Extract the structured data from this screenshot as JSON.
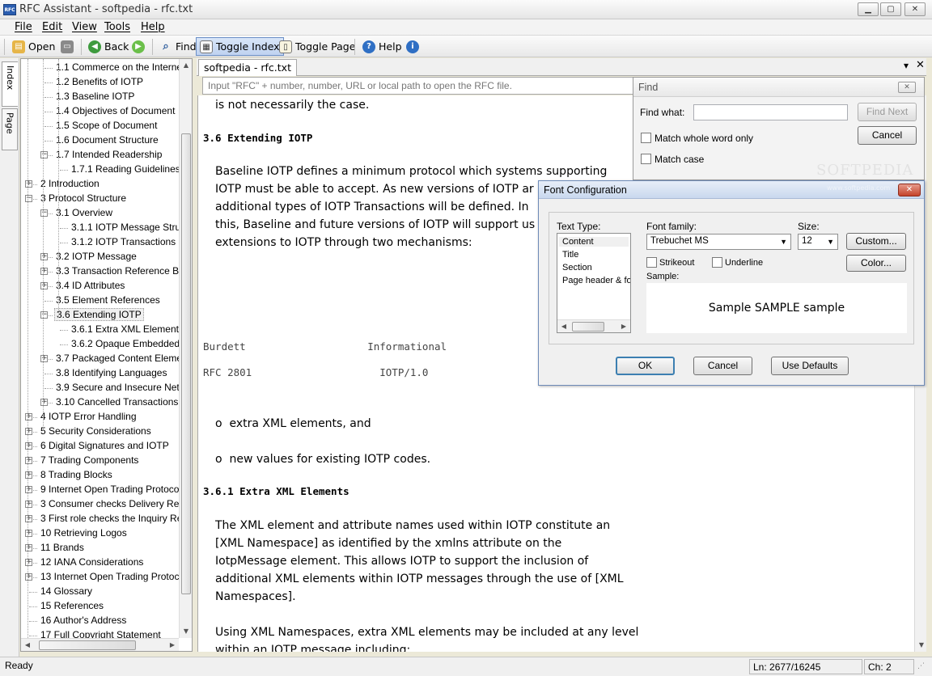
{
  "window": {
    "title": "RFC Assistant - softpedia - rfc.txt",
    "app_icon_text": "RFC",
    "minimize_glyph": "▁",
    "maximize_glyph": "▢",
    "close_glyph": "✕"
  },
  "menu": [
    {
      "label": "File"
    },
    {
      "label": "Edit"
    },
    {
      "label": "View"
    },
    {
      "label": "Tools"
    },
    {
      "label": "Help"
    }
  ],
  "toolbar": {
    "open_label": "Open",
    "back_label": "Back",
    "find_label": "Find",
    "toggle_index_label": "Toggle Index",
    "toggle_page_label": "Toggle Page",
    "help_label": "Help",
    "icons": [
      "folder-open-icon",
      "printer-icon",
      "back-arrow-icon",
      "forward-arrow-icon",
      "magnifier-icon",
      "toggle-index-icon",
      "toggle-page-icon",
      "help-icon",
      "info-icon"
    ]
  },
  "side_tabs": {
    "index_label": "Index",
    "page_label": "Page"
  },
  "tree": [
    {
      "label": "1.1 Commerce on the Interne",
      "depth": 2
    },
    {
      "label": "1.2 Benefits of IOTP",
      "depth": 2
    },
    {
      "label": "1.3 Baseline IOTP",
      "depth": 2
    },
    {
      "label": "1.4 Objectives of Document",
      "depth": 2
    },
    {
      "label": "1.5 Scope of Document",
      "depth": 2
    },
    {
      "label": "1.6 Document Structure",
      "depth": 2
    },
    {
      "label": "1.7 Intended Readership",
      "depth": 2,
      "expander": "−"
    },
    {
      "label": "1.7.1 Reading Guidelines",
      "depth": 3
    },
    {
      "label": "2 Introduction",
      "depth": 1,
      "expander": "+"
    },
    {
      "label": "3 Protocol Structure",
      "depth": 1,
      "expander": "−"
    },
    {
      "label": "3.1 Overview",
      "depth": 2,
      "expander": "−"
    },
    {
      "label": "3.1.1 IOTP Message Struc",
      "depth": 3
    },
    {
      "label": "3.1.2 IOTP Transactions",
      "depth": 3
    },
    {
      "label": "3.2 IOTP Message",
      "depth": 2,
      "expander": "+"
    },
    {
      "label": "3.3 Transaction Reference Blo",
      "depth": 2,
      "expander": "+"
    },
    {
      "label": "3.4 ID Attributes",
      "depth": 2,
      "expander": "+"
    },
    {
      "label": "3.5 Element References",
      "depth": 2
    },
    {
      "label": "3.6 Extending IOTP",
      "depth": 2,
      "expander": "−",
      "selected": true
    },
    {
      "label": "3.6.1 Extra XML Elements",
      "depth": 3
    },
    {
      "label": "3.6.2 Opaque Embedded",
      "depth": 3
    },
    {
      "label": "3.7 Packaged Content Eleme",
      "depth": 2,
      "expander": "+"
    },
    {
      "label": "3.8 Identifying Languages",
      "depth": 2
    },
    {
      "label": "3.9 Secure and Insecure Net I",
      "depth": 2
    },
    {
      "label": "3.10 Cancelled Transactions",
      "depth": 2,
      "expander": "+"
    },
    {
      "label": "4 IOTP Error Handling",
      "depth": 1,
      "expander": "+"
    },
    {
      "label": "5 Security Considerations",
      "depth": 1,
      "expander": "+"
    },
    {
      "label": "6 Digital Signatures and IOTP",
      "depth": 1,
      "expander": "+"
    },
    {
      "label": "7 Trading Components",
      "depth": 1,
      "expander": "+"
    },
    {
      "label": "8 Trading Blocks",
      "depth": 1,
      "expander": "+"
    },
    {
      "label": "9 Internet Open Trading Protoco",
      "depth": 1,
      "expander": "+"
    },
    {
      "label": "3 Consumer checks Delivery Res",
      "depth": 1,
      "expander": "+"
    },
    {
      "label": "3 First role checks the Inquiry Re",
      "depth": 1,
      "expander": "+"
    },
    {
      "label": "10 Retrieving Logos",
      "depth": 1,
      "expander": "+"
    },
    {
      "label": "11 Brands",
      "depth": 1,
      "expander": "+"
    },
    {
      "label": "12 IANA Considerations",
      "depth": 1,
      "expander": "+"
    },
    {
      "label": "13 Internet Open Trading Protoc",
      "depth": 1,
      "expander": "+"
    },
    {
      "label": "14 Glossary",
      "depth": 1
    },
    {
      "label": "15 References",
      "depth": 1
    },
    {
      "label": "16 Author's Address",
      "depth": 1
    },
    {
      "label": "17 Full Copyright Statement",
      "depth": 1
    }
  ],
  "document": {
    "tab_label": "softpedia - rfc.txt",
    "input_placeholder": "Input \"RFC\" + number, number, URL or local path to open the RFC file.",
    "tab_menu_glyph": "▾",
    "tab_close_glyph": "✕",
    "lines": [
      {
        "text": "is not necessarily the case.",
        "style": "body",
        "indent": 1
      },
      {
        "text": "3.6 Extending IOTP",
        "style": "head",
        "indent": 0
      },
      {
        "text": "Baseline IOTP defines a minimum protocol which systems supporting",
        "style": "body",
        "indent": 1
      },
      {
        "text": "IOTP must be able to accept. As new versions of IOTP ar",
        "style": "body",
        "indent": 1
      },
      {
        "text": "additional types of IOTP Transactions will be defined. In",
        "style": "body",
        "indent": 1
      },
      {
        "text": "this, Baseline and future versions of IOTP will support us",
        "style": "body",
        "indent": 1
      },
      {
        "text": "extensions to IOTP through two mechanisms:",
        "style": "body",
        "indent": 1
      },
      {
        "text": "Burdett                    Informational",
        "style": "mono",
        "indent": 0
      },
      {
        "text": "RFC 2801                     IOTP/1.0",
        "style": "mono",
        "indent": 0
      },
      {
        "text": "o  extra XML elements, and",
        "style": "body",
        "indent": 1
      },
      {
        "text": "o  new values for existing IOTP codes.",
        "style": "body",
        "indent": 1
      },
      {
        "text": "3.6.1 Extra XML Elements",
        "style": "head",
        "indent": 0
      },
      {
        "text": "The XML element and attribute names used within IOTP constitute an",
        "style": "body",
        "indent": 1
      },
      {
        "text": "[XML Namespace] as identified by the xmlns attribute on the",
        "style": "body",
        "indent": 1
      },
      {
        "text": "IotpMessage element. This allows IOTP to support the inclusion of",
        "style": "body",
        "indent": 1
      },
      {
        "text": "additional XML elements within IOTP messages through the use of [XML",
        "style": "body",
        "indent": 1
      },
      {
        "text": "Namespaces].",
        "style": "body",
        "indent": 1
      },
      {
        "text": "Using XML Namespaces, extra XML elements may be included at any level",
        "style": "body",
        "indent": 1
      },
      {
        "text": "within an IOTP message including:",
        "style": "body",
        "indent": 1
      }
    ]
  },
  "find_dialog": {
    "title": "Find",
    "find_what_label": "Find what:",
    "find_what_value": "",
    "find_next_label": "Find Next",
    "cancel_label": "Cancel",
    "match_whole_word_label": "Match whole word only",
    "match_case_label": "Match case",
    "watermark": "SOFTPEDIA",
    "watermark_url": "www.softpedia.com"
  },
  "font_dialog": {
    "title": "Font Configuration",
    "text_type_label": "Text Type:",
    "text_types": [
      "Content",
      "Title",
      "Section",
      "Page header & fo"
    ],
    "selected_text_type": "Content",
    "font_family_label": "Font family:",
    "font_family_value": "Trebuchet MS",
    "size_label": "Size:",
    "size_value": "12",
    "custom_label": "Custom...",
    "color_label": "Color...",
    "strikeout_label": "Strikeout",
    "underline_label": "Underline",
    "sample_label": "Sample:",
    "sample_text": "Sample SAMPLE sample",
    "ok_label": "OK",
    "cancel_label": "Cancel",
    "use_defaults_label": "Use Defaults"
  },
  "status": {
    "ready": "Ready",
    "line": "Ln: 2677/16245",
    "char": "Ch: 2"
  },
  "colors": {
    "accent": "#3C7FB1",
    "selection_bg": "#F0F0F0",
    "close_red": "#C4432B"
  }
}
